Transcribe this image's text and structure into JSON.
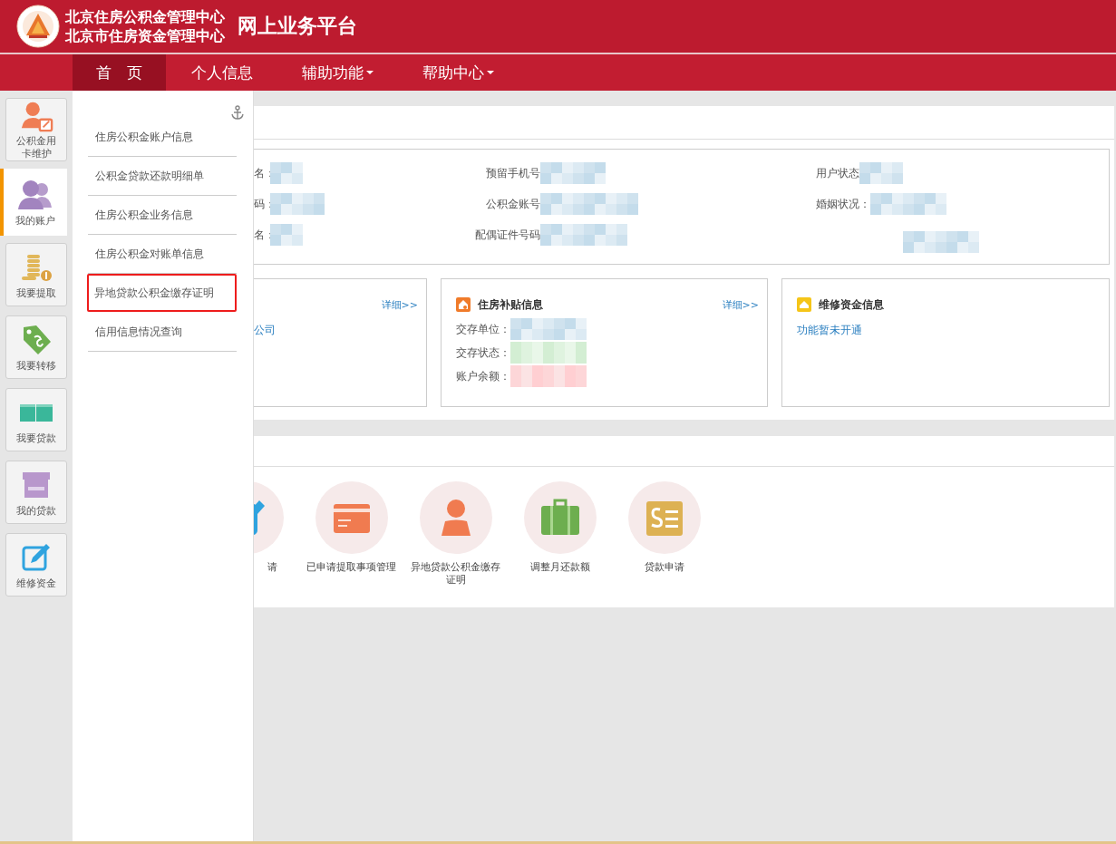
{
  "header": {
    "org_lines": [
      "北京住房公积金管理中心",
      "北京市住房资金管理中心"
    ],
    "platform": "网上业务平台"
  },
  "nav": [
    {
      "label": "首　页",
      "selected": true,
      "dropdown": false
    },
    {
      "label": "个人信息",
      "selected": false,
      "dropdown": false
    },
    {
      "label": "辅助功能",
      "selected": false,
      "dropdown": true
    },
    {
      "label": "帮助中心",
      "selected": false,
      "dropdown": true
    }
  ],
  "sidebar": [
    {
      "label": "公积金用卡维护",
      "kind": "user-card",
      "selected": false
    },
    {
      "label": "我的账户",
      "kind": "users",
      "selected": true
    },
    {
      "label": "我要提取",
      "kind": "coins",
      "selected": false
    },
    {
      "label": "我要转移",
      "kind": "tag",
      "selected": false
    },
    {
      "label": "我要贷款",
      "kind": "cash",
      "selected": false
    },
    {
      "label": "我的贷款",
      "kind": "shop",
      "selected": false
    },
    {
      "label": "维修资金",
      "kind": "edit",
      "selected": false
    }
  ],
  "flyout": {
    "items": [
      {
        "label": "住房公积金账户信息",
        "highlighted": false
      },
      {
        "label": "公积金贷款还款明细单",
        "highlighted": false
      },
      {
        "label": "住房公积金业务信息",
        "highlighted": false
      },
      {
        "label": "住房公积金对账单信息",
        "highlighted": false
      },
      {
        "label": "异地贷款公积金缴存证明",
        "highlighted": true
      },
      {
        "label": "信用信息情况查询",
        "highlighted": false
      }
    ]
  },
  "info": {
    "rows": [
      [
        "名：",
        "预留手机号",
        "用户状态"
      ],
      [
        "码：",
        "公积金账号",
        "婚姻状况："
      ],
      [
        "名：",
        "配偶证件号码",
        ""
      ]
    ]
  },
  "cards": [
    {
      "kind": "clipped",
      "link": "详细>>",
      "lines": [
        "公司"
      ]
    },
    {
      "kind": "subsidy",
      "title": "住房补贴信息",
      "link": "详细>>",
      "lines": [
        "交存单位：",
        "交存状态：",
        "账户余额："
      ]
    },
    {
      "kind": "repair",
      "title": "维修资金信息",
      "notice": "功能暂未开通"
    }
  ],
  "shortcuts": [
    {
      "label": "请",
      "kind": "edit",
      "clipped": true
    },
    {
      "label": "已申请提取事项管理",
      "kind": "card",
      "clipped": false
    },
    {
      "label": "异地贷款公积金缴存证明",
      "kind": "person",
      "clipped": false
    },
    {
      "label": "调整月还款额",
      "kind": "suitcase",
      "clipped": false
    },
    {
      "label": "贷款申请",
      "kind": "bill",
      "clipped": false
    }
  ]
}
